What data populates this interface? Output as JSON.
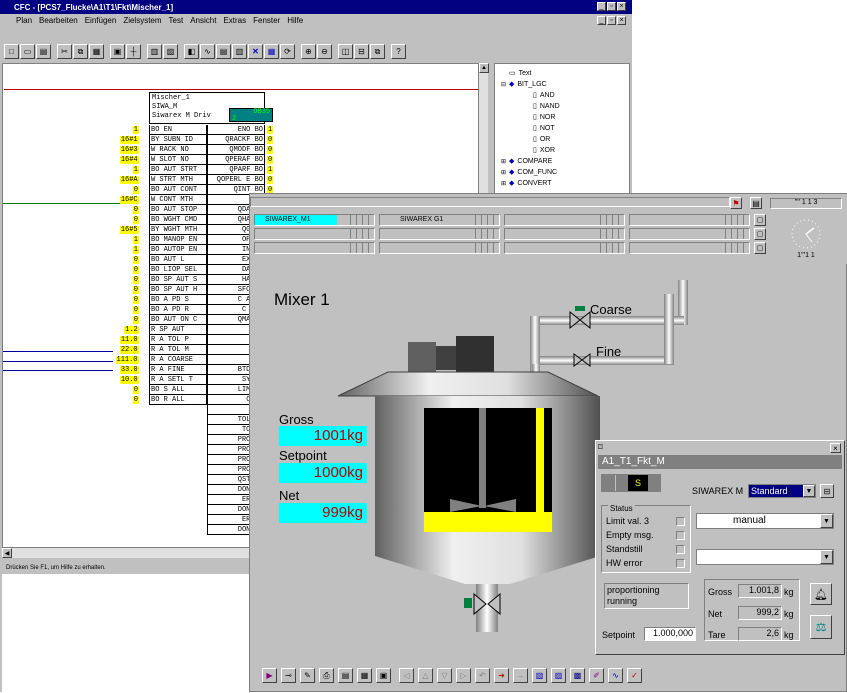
{
  "cfc": {
    "title": "CFC - [PCS7_Flucke\\A1\\T1\\Fkt\\Mischer_1]",
    "menu": [
      "Plan",
      "Bearbeiten",
      "Einfügen",
      "Zielsystem",
      "Test",
      "Ansicht",
      "Extras",
      "Fenster",
      "Hilfe"
    ],
    "status": "Drücken Sie F1, um Hilfe zu erhalten.",
    "block": {
      "name": "Mischer_1",
      "type": "SIWA_M",
      "desc": "Siwarex M Driv",
      "ob": "OB35",
      "ob_sub": "2"
    },
    "rows": [
      {
        "in": "1",
        "l": "BO EN",
        "r": "ENO BO",
        "out": "1"
      },
      {
        "in": "16#1",
        "l": "BY SUBN ID",
        "r": "QRACKF BO",
        "out": "0"
      },
      {
        "in": "16#3",
        "l": "W RACK NO",
        "r": "QMODF BO",
        "out": "0"
      },
      {
        "in": "16#4",
        "l": "W SLOT NO",
        "r": "QPERAF BO",
        "out": "0"
      },
      {
        "in": "1",
        "l": "BO AUT STRT",
        "r": "QPARF BO",
        "out": "1"
      },
      {
        "in": "16#A",
        "l": "W STRT MTH",
        "r": "QOPERL E BO",
        "out": "0"
      },
      {
        "in": "0",
        "l": "BO AUT CONT",
        "r": "QINT BO",
        "out": "0"
      },
      {
        "in": "16#C",
        "l": "W CONT MTH",
        "r": "QE",
        "out": ""
      },
      {
        "in": "0",
        "l": "BO AUT STOP",
        "r": "QDAT R",
        "out": ""
      },
      {
        "in": "0",
        "l": "BO WGHT CMD",
        "r": "QHANDL",
        "out": ""
      },
      {
        "in": "16#5",
        "l": "BY WGHT MTH",
        "r": "QGR R",
        "out": ""
      },
      {
        "in": "1",
        "l": "BO MANOP EN",
        "r": "OPERL",
        "out": ""
      },
      {
        "in": "1",
        "l": "BO AUTOP EN",
        "r": "INT E",
        "out": ""
      },
      {
        "in": "0",
        "l": "BO AUT L",
        "r": "EXT E",
        "out": ""
      },
      {
        "in": "0",
        "l": "BO LIOP SEL",
        "r": "DAT E",
        "out": ""
      },
      {
        "in": "0",
        "l": "BO SP AUT S",
        "r": "HANDL",
        "out": ""
      },
      {
        "in": "0",
        "l": "BO SP AUT H",
        "r": "SFC RE",
        "out": ""
      },
      {
        "in": "0",
        "l": "BO A PD S",
        "r": "C A DC",
        "out": ""
      },
      {
        "in": "0",
        "l": "BO A PD R",
        "r": "C A E",
        "out": ""
      },
      {
        "in": "0",
        "l": "BO AUT ON C",
        "r": "QMAN A",
        "out": ""
      },
      {
        "in": "1.2",
        "l": "R SP AUT",
        "r": "GRC",
        "out": ""
      },
      {
        "in": "11.0",
        "l": "R A TOL P",
        "r": "N",
        "out": ""
      },
      {
        "in": "22.0",
        "l": "R A TOL M",
        "r": "TA",
        "out": ""
      },
      {
        "in": "111.0",
        "l": "R A COARSE",
        "r": "EMP",
        "out": ""
      },
      {
        "in": "33.0",
        "l": "R A FINE",
        "r": "BTDSTI",
        "out": ""
      },
      {
        "in": "10.0",
        "l": "R A SETL T",
        "r": "SYS E",
        "out": ""
      },
      {
        "in": "0",
        "l": "BO S ALL",
        "r": "LIM VA",
        "out": ""
      },
      {
        "in": "0",
        "l": "BO R ALL",
        "r": "COAR",
        "out": ""
      },
      {
        "in": "",
        "l": "",
        "r": "FI",
        "out": ""
      },
      {
        "in": "",
        "l": "",
        "r": "TOL PL",
        "out": ""
      },
      {
        "in": "",
        "l": "",
        "r": "TOL M",
        "out": ""
      },
      {
        "in": "",
        "l": "",
        "r": "PROP E",
        "out": ""
      },
      {
        "in": "",
        "l": "",
        "r": "PROP S",
        "out": ""
      },
      {
        "in": "",
        "l": "",
        "r": "PROP A",
        "out": ""
      },
      {
        "in": "",
        "l": "",
        "r": "PROP R",
        "out": ""
      },
      {
        "in": "",
        "l": "",
        "r": "QSTART",
        "out": ""
      },
      {
        "in": "",
        "l": "",
        "r": "DONE S",
        "out": ""
      },
      {
        "in": "",
        "l": "",
        "r": "ERR S",
        "out": ""
      },
      {
        "in": "",
        "l": "",
        "r": "DONE F",
        "out": ""
      },
      {
        "in": "",
        "l": "",
        "r": "ERR F",
        "out": ""
      },
      {
        "in": "",
        "l": "",
        "r": "DONE S",
        "out": ""
      }
    ],
    "tree": [
      {
        "t": "Text",
        "lvl": 1,
        "icon": "page-icon"
      },
      {
        "t": "BIT_LGC",
        "lvl": 1,
        "icon": "library-icon",
        "exp": "-"
      },
      {
        "t": "AND",
        "lvl": 2,
        "icon": "block-icon"
      },
      {
        "t": "NAND",
        "lvl": 2,
        "icon": "block-icon"
      },
      {
        "t": "NOR",
        "lvl": 2,
        "icon": "block-icon"
      },
      {
        "t": "NOT",
        "lvl": 2,
        "icon": "block-icon"
      },
      {
        "t": "OR",
        "lvl": 2,
        "icon": "block-icon"
      },
      {
        "t": "XOR",
        "lvl": 2,
        "icon": "block-icon"
      },
      {
        "t": "COMPARE",
        "lvl": 1,
        "icon": "library-icon",
        "exp": "+"
      },
      {
        "t": "COM_FUNC",
        "lvl": 1,
        "icon": "library-icon",
        "exp": "+"
      },
      {
        "t": "CONVERT",
        "lvl": 1,
        "icon": "library-icon",
        "exp": "+"
      }
    ]
  },
  "wincc": {
    "clock": "1'''1 1",
    "clock_top": "'''' 1 1 3",
    "tabs": [
      "SIWAREX_M1",
      "SIWAREX G1"
    ],
    "title": "Mixer 1",
    "coarse": "Coarse",
    "fine": "Fine",
    "gross_label": "Gross",
    "gross": "1001kg",
    "setpoint_label": "Setpoint",
    "setpoint": "1000kg",
    "net_label": "Net",
    "net": "999kg"
  },
  "faceplate": {
    "title": "A1_T1_Fkt_M",
    "s": "S",
    "device": "SIWAREX M",
    "mode_select": "Standard",
    "status_title": "Status",
    "status": [
      "Limit val. 3",
      "Empty msg.",
      "Standstill",
      "HW error"
    ],
    "op_mode": "manual",
    "message": "proportioning running",
    "gross_label": "Gross",
    "gross": "1.001,8",
    "net_label": "Net",
    "net": "999,2",
    "tare_label": "Tare",
    "tare": "2,6",
    "unit": "kg",
    "setpoint_label": "Setpoint",
    "setpoint": "1.000,000"
  },
  "colors": {
    "title": "#000080",
    "cyan": "#00ffff",
    "yellow": "#ffff00",
    "gray": "#c0c0c0",
    "value": "#c00000"
  }
}
